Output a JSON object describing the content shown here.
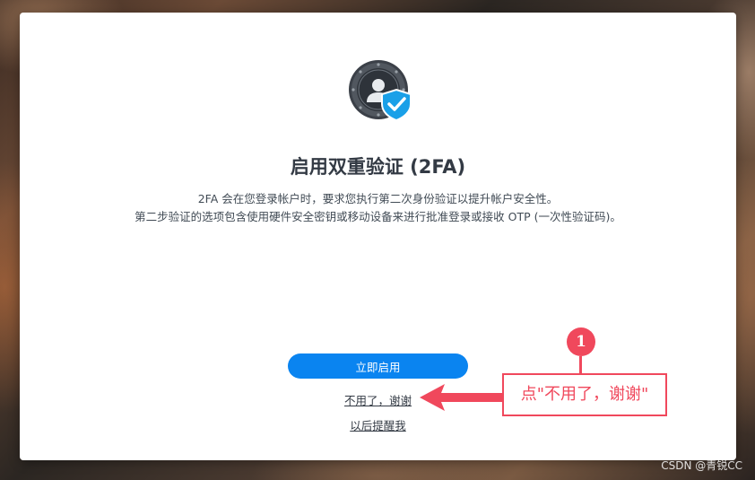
{
  "dialog": {
    "title": "启用双重验证 (2FA)",
    "description_line1": "2FA 会在您登录帐户时，要求您执行第二次身份验证以提升帐户安全性。",
    "description_line2": "第二步验证的选项包含使用硬件安全密钥或移动设备来进行批准登录或接收 OTP (一次性验证码)。",
    "enable_button": "立即启用",
    "decline_link": "不用了，谢谢",
    "later_link": "以后提醒我"
  },
  "annotation": {
    "step_number": "1",
    "callout_text": "点\"不用了，谢谢\"",
    "color": "#f0485c"
  },
  "watermark": "CSDN @青锐CC",
  "colors": {
    "primary_button": "#0a84f0",
    "shield": "#1aa0e8"
  },
  "icons": {
    "logo": "user-shield-icon",
    "check": "check-icon"
  }
}
